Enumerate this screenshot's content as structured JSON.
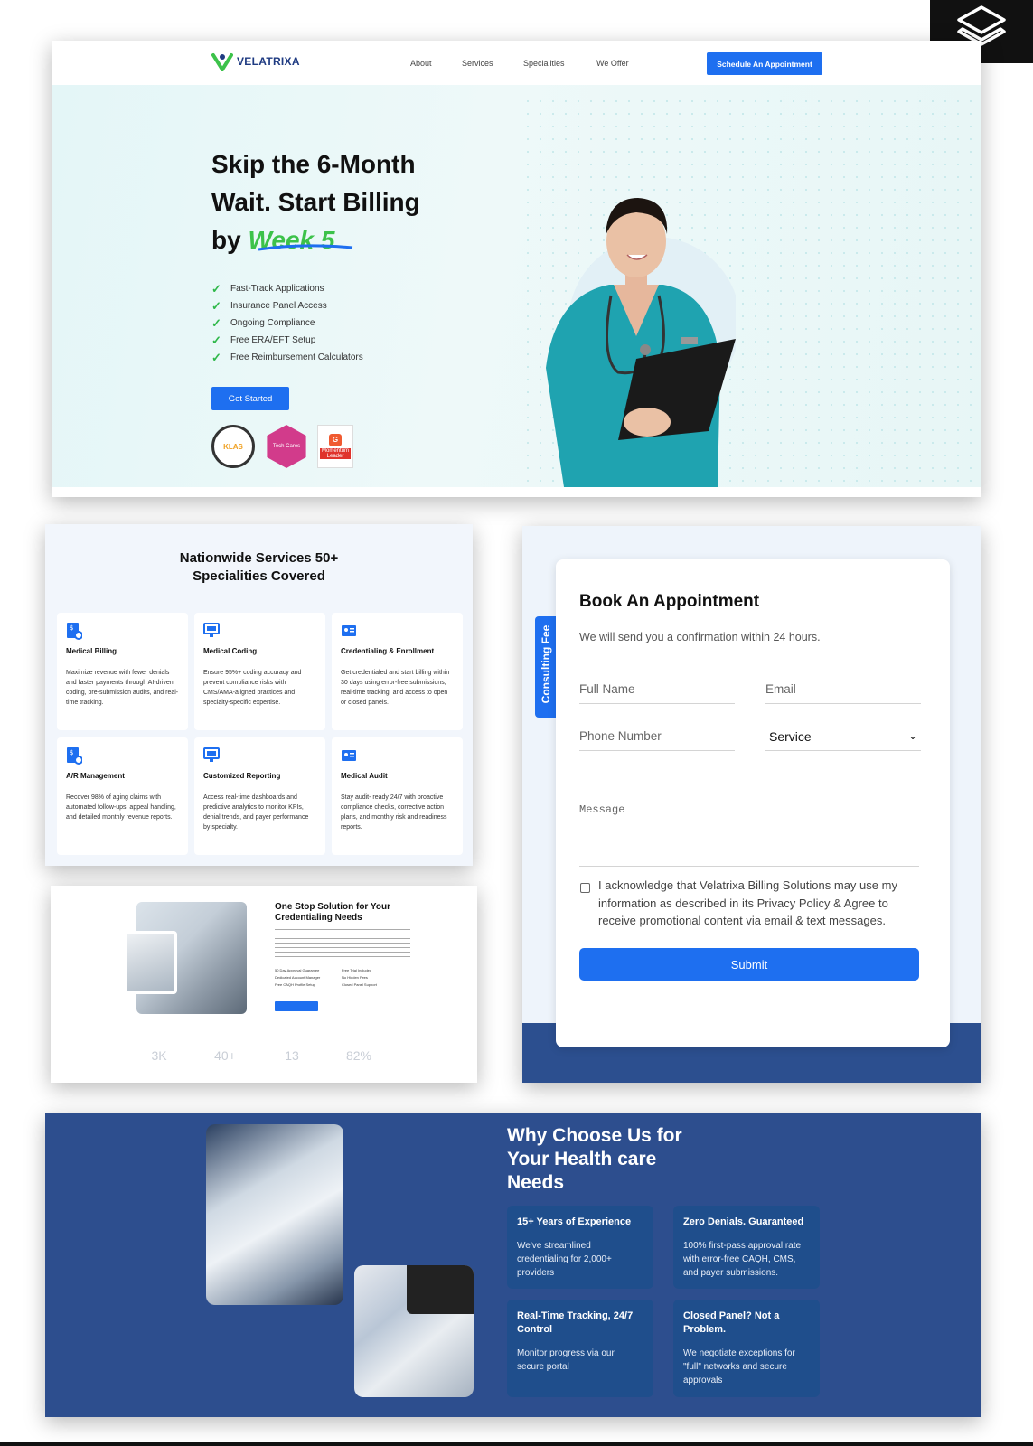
{
  "hero": {
    "brand": "VELATRIXA",
    "nav": [
      "About",
      "Services",
      "Specialities",
      "We Offer"
    ],
    "cta": "Schedule An Appointment",
    "headline_1": "Skip the 6-Month",
    "headline_2": "Wait. Start Billing",
    "headline_3": "by",
    "headline_highlight": "Week 5",
    "checks": [
      "Fast-Track Applications",
      "Insurance Panel Access",
      "Ongoing Compliance",
      "Free ERA/EFT Setup",
      "Free Reimbursement Calculators"
    ],
    "get_started": "Get Started",
    "badge_klas": "KLAS",
    "badge_tech": "Tech Cares",
    "badge_g2": "Momentum Leader"
  },
  "specialities": {
    "title_1": "Nationwide Services 50+",
    "title_2": "Specialities Covered",
    "cards": [
      {
        "title": "Medical Billing",
        "text": "Maximize revenue with fewer denials and faster payments through AI-driven coding, pre-submission audits, and real-time tracking.",
        "icon": "billing-icon"
      },
      {
        "title": "Medical Coding",
        "text": "Ensure 95%+ coding accuracy and prevent compliance risks with CMS/AMA-aligned practices and specialty-specific expertise.",
        "icon": "monitor-icon"
      },
      {
        "title": "Credentialing & Enrollment",
        "text": "Get credentialed and start billing within 30 days using error-free submissions, real-time tracking, and access to open or closed panels.",
        "icon": "id-card-icon"
      },
      {
        "title": "A/R Management",
        "text": "Recover 98% of aging claims with automated follow-ups, appeal handling, and detailed monthly revenue reports.",
        "icon": "billing-icon"
      },
      {
        "title": "Customized Reporting",
        "text": "Access real-time dashboards and predictive analytics to monitor KPIs, denial trends, and payer performance by specialty.",
        "icon": "monitor-icon"
      },
      {
        "title": "Medical Audit",
        "text": "Stay audit- ready 24/7 with proactive compliance checks, corrective action plans, and monthly risk and readiness reports.",
        "icon": "id-card-icon"
      }
    ]
  },
  "credentialing": {
    "title": "One Stop Solution for Your Credentialing Needs",
    "bullets_left": [
      "50 Day Approval Guarantee",
      "Dedicated Account Manager",
      "Free CAQH Profile Setup"
    ],
    "bullets_right": [
      "Free Trial Included",
      "No Hidden Fees",
      "Closed Panel Support"
    ],
    "stats": [
      "3K",
      "40+",
      "13",
      "82%"
    ]
  },
  "booking": {
    "tab": "Consulting Fee",
    "title": "Book An Appointment",
    "subtitle": "We will send you a confirmation within 24 hours.",
    "full_name": "Full Name",
    "email": "Email",
    "phone": "Phone Number",
    "service": "Service",
    "message": "Message",
    "ack_1": "I acknowledge that Velatrixa Billing Solutions may use my",
    "ack_2": "information as described in its Privacy Policy & Agree to",
    "ack_3": "receive promotional content via email & text messages.",
    "submit": "Submit"
  },
  "why": {
    "title_1": "Why Choose Us for",
    "title_2": "Your Health care",
    "title_3": "Needs",
    "cards": [
      {
        "title": "15+ Years of Experience",
        "text": "We've streamlined credentialing for 2,000+ providers"
      },
      {
        "title": "Zero Denials. Guaranteed",
        "text": "100% first-pass approval rate with error-free CAQH, CMS, and payer submissions."
      },
      {
        "title": "Real-Time Tracking, 24/7 Control",
        "text": "Monitor progress via our secure portal"
      },
      {
        "title": "Closed Panel? Not a Problem.",
        "text": "We negotiate exceptions for \"full\" networks and secure approvals"
      }
    ]
  },
  "colors": {
    "accent": "#1e6ff0",
    "green": "#3cc24a",
    "navy": "#2d4e8e"
  }
}
